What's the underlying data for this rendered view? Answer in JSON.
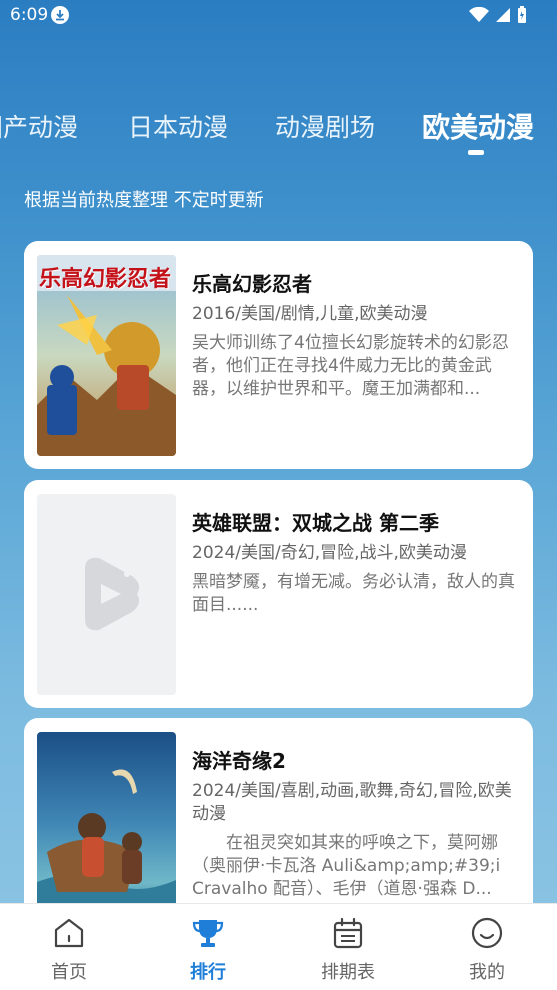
{
  "status": {
    "time": "6:09"
  },
  "tabs": [
    {
      "label": "国产动漫"
    },
    {
      "label": "日本动漫"
    },
    {
      "label": "动漫剧场"
    },
    {
      "label": "欧美动漫"
    }
  ],
  "subtitle": "根据当前热度整理 不定时更新",
  "items": [
    {
      "title": "乐高幻影忍者",
      "meta": "2016/美国/剧情,儿童,欧美动漫",
      "desc": "吴大师训练了4位擅长幻影旋转术的幻影忍者，他们正在寻找4件威力无比的黄金武器，以维护世界和平。魔王加满都和...",
      "poster_text": "乐高幻影忍者"
    },
    {
      "title": "英雄联盟：双城之战 第二季",
      "meta": "2024/美国/奇幻,冒险,战斗,欧美动漫",
      "desc": "黑暗梦魇，有增无减。务必认清，敌人的真面目......"
    },
    {
      "title": "海洋奇缘2",
      "meta": "2024/美国/喜剧,动画,歌舞,奇幻,冒险,欧美动漫",
      "desc": "　　在祖灵突如其来的呼唤之下，莫阿娜（奥丽伊·卡瓦洛 Auli&amp;amp;#39;i Cravalho 配音）、毛伊（道恩·强森 D..."
    }
  ],
  "nav": [
    {
      "label": "首页"
    },
    {
      "label": "排行"
    },
    {
      "label": "排期表"
    },
    {
      "label": "我的"
    }
  ],
  "colors": {
    "accent": "#1f7fd8"
  }
}
